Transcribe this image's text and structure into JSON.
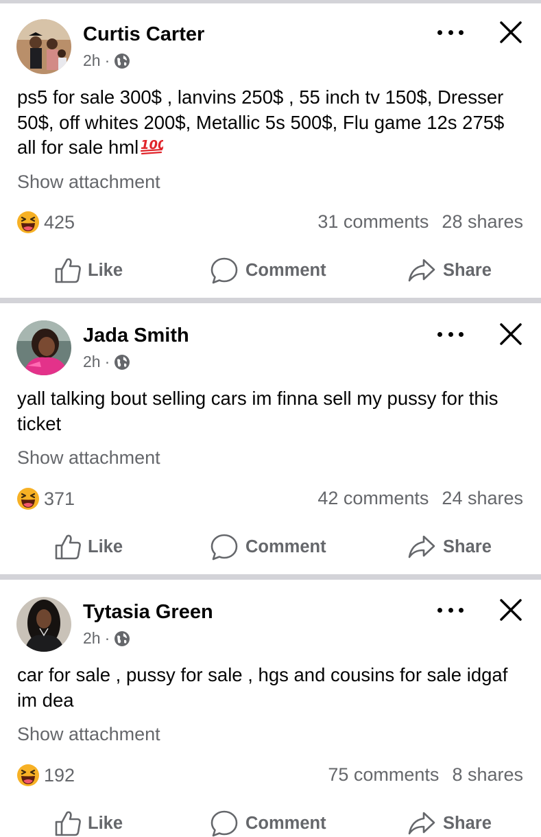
{
  "colors": {
    "divider": "#d3d3d8",
    "text": "#050505",
    "secondary": "#65676b",
    "emoji_face": "#f7b125",
    "hundred_red": "#e0242a"
  },
  "posts": [
    {
      "author": "Curtis Carter",
      "time": "2h",
      "meta_sep": "·",
      "text": "ps5 for sale 300$ , lanvins 250$ , 55 inch tv 150$, Dresser 50$, off whites 200$, Metallic 5s 500$, Flu game 12s 275$ all for sale hml",
      "text_emoji": "100",
      "show_attachment": "Show attachment",
      "reaction_count": "425",
      "comments": "31 comments",
      "shares": "28 shares",
      "like": "Like",
      "comment": "Comment",
      "share": "Share"
    },
    {
      "author": "Jada Smith",
      "time": "2h",
      "meta_sep": "·",
      "text": "yall talking bout selling cars im finna sell my pussy for this ticket",
      "show_attachment": "Show attachment",
      "reaction_count": "371",
      "comments": "42 comments",
      "shares": "24 shares",
      "like": "Like",
      "comment": "Comment",
      "share": "Share"
    },
    {
      "author": "Tytasia Green",
      "time": "2h",
      "meta_sep": "·",
      "text": "car for sale , pussy for sale , hgs and cousins for sale idgaf im dea",
      "show_attachment": "Show attachment",
      "reaction_count": "192",
      "comments": "75 comments",
      "shares": "8 shares",
      "like": "Like",
      "comment": "Comment",
      "share": "Share"
    }
  ],
  "icons": {
    "more": "more-horizontal-icon",
    "close": "close-icon",
    "globe": "globe-icon",
    "reaction": "haha-reaction-icon",
    "like": "thumbs-up-icon",
    "comment": "speech-bubble-icon",
    "share": "share-arrow-icon"
  }
}
